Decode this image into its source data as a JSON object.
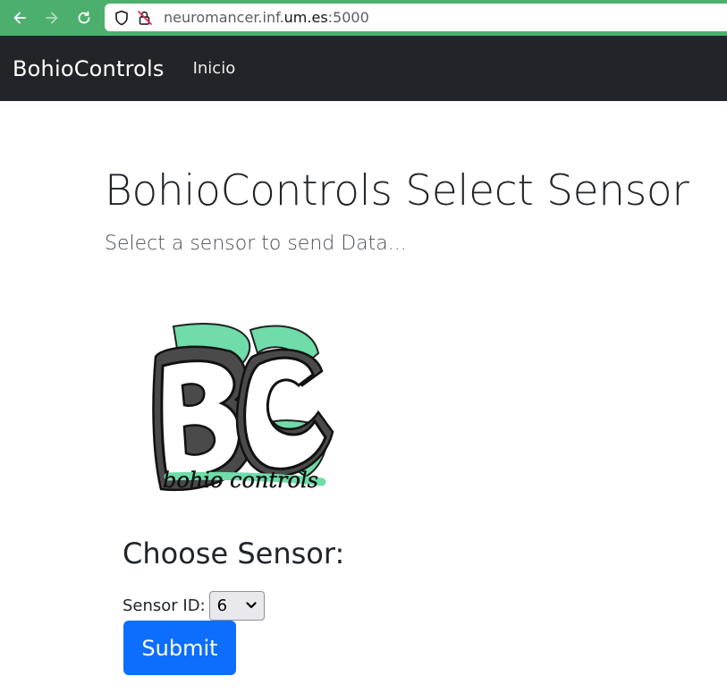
{
  "browser": {
    "url_prefix": "neuromancer.inf.",
    "url_domain": "um.es",
    "url_suffix": ":5000",
    "icons": [
      "back-arrow-icon",
      "forward-arrow-icon",
      "reload-icon",
      "shield-icon",
      "insecure-lock-icon"
    ]
  },
  "navbar": {
    "brand": "BohioControls",
    "links": [
      {
        "label": "Inicio"
      }
    ]
  },
  "main": {
    "title": "BohioControls Select Sensor",
    "lead": "Select a sensor to send Data...",
    "logo_text": "bohio controls",
    "section_title": "Choose Sensor:",
    "form": {
      "label": "Sensor ID:",
      "selected": "6",
      "submit_label": "Submit"
    }
  },
  "colors": {
    "browser_bar": "#4caf6e",
    "navbar_bg": "#212529",
    "primary_button": "#0d6efd",
    "logo_mint": "#6fdcaa",
    "logo_gray": "#4a4a4a"
  }
}
